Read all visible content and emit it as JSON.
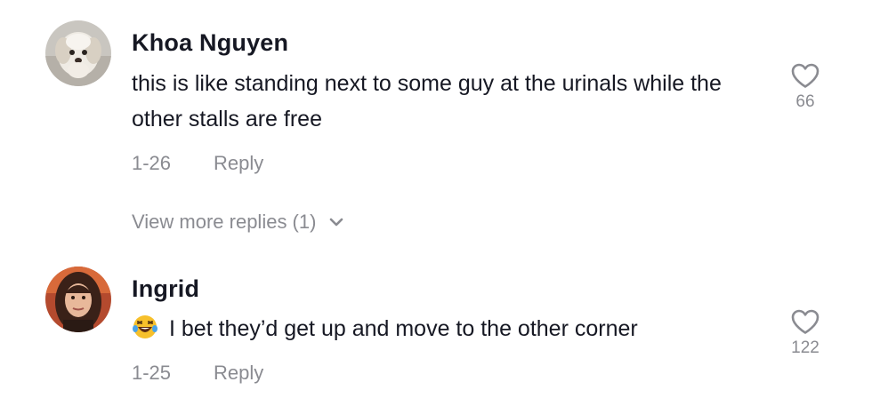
{
  "comments": [
    {
      "username": "Khoa Nguyen",
      "text": "this is like standing next to some guy at the urinals while the other stalls are free",
      "date": "1-26",
      "reply_label": "Reply",
      "like_count": "66",
      "avatar_icon": "dog-avatar-icon"
    },
    {
      "username": "Ingrid",
      "emoji_icon": "laughing-tears-emoji-icon",
      "text": "I bet they’d get up and move to the other corner",
      "date": "1-25",
      "reply_label": "Reply",
      "like_count": "122",
      "avatar_icon": "woman-avatar-icon"
    }
  ],
  "view_more_replies": "View more replies (1)",
  "colors": {
    "primary_text": "#161823",
    "secondary_text": "#8a8b91"
  }
}
